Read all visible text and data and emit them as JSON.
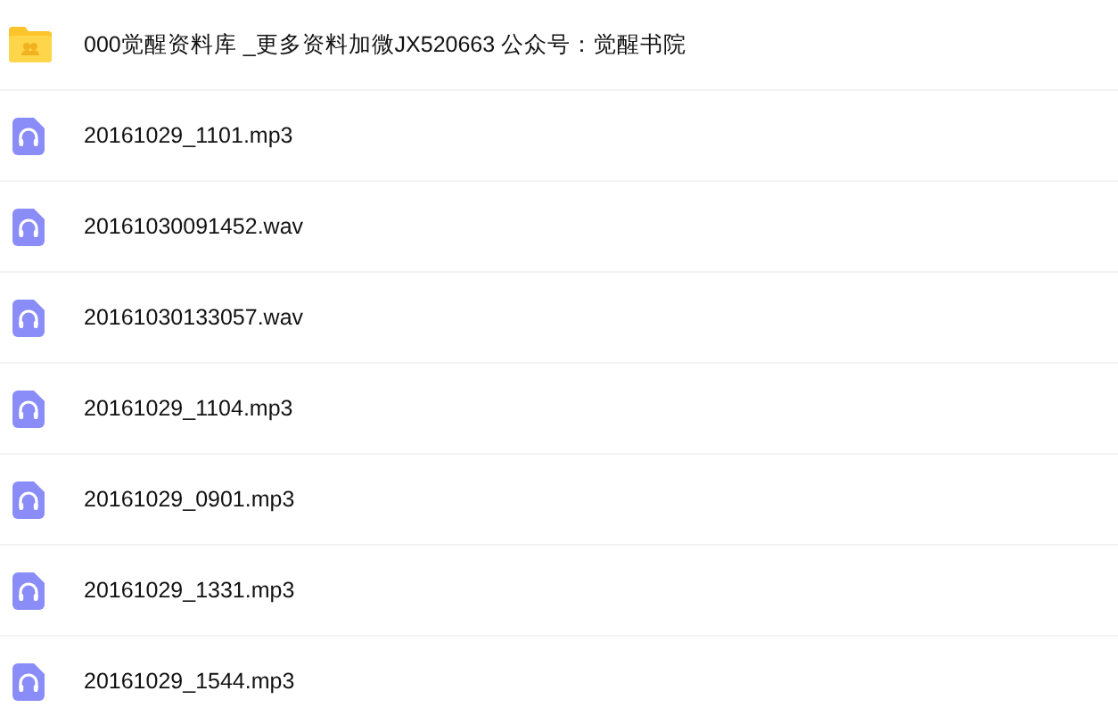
{
  "files": [
    {
      "kind": "folder",
      "name": "000觉醒资料库 _更多资料加微JX520663 公众号：觉醒书院"
    },
    {
      "kind": "audio",
      "name": "20161029_1101.mp3"
    },
    {
      "kind": "audio",
      "name": "20161030091452.wav"
    },
    {
      "kind": "audio",
      "name": "20161030133057.wav"
    },
    {
      "kind": "audio",
      "name": "20161029_1104.mp3"
    },
    {
      "kind": "audio",
      "name": "20161029_0901.mp3"
    },
    {
      "kind": "audio",
      "name": "20161029_1331.mp3"
    },
    {
      "kind": "audio",
      "name": "20161029_1544.mp3"
    }
  ]
}
